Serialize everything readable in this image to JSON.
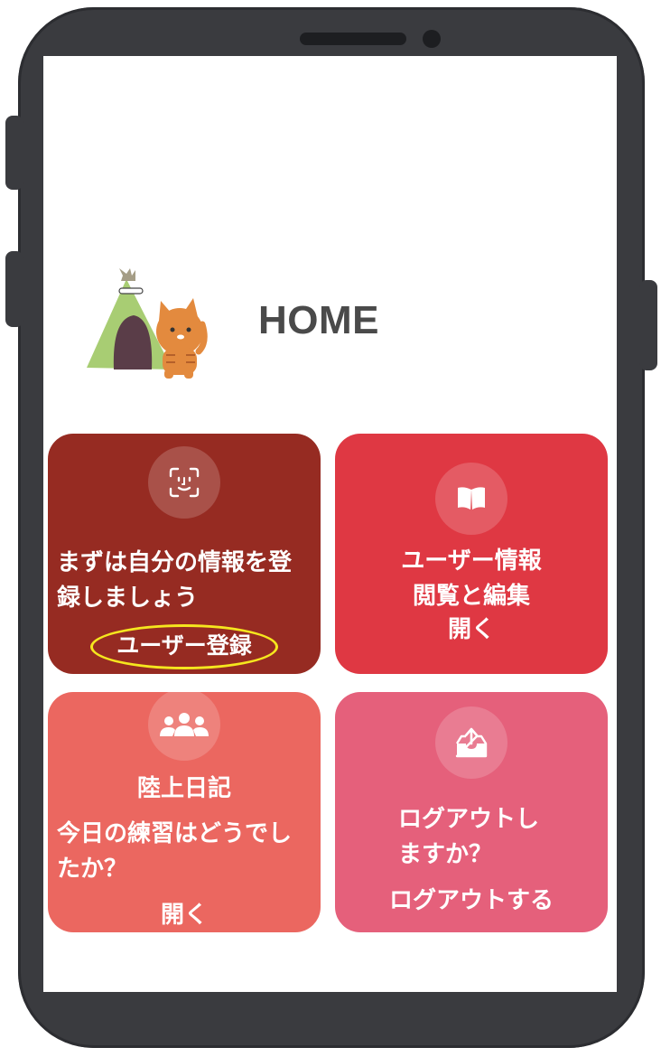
{
  "header": {
    "title": "HOME"
  },
  "tiles": {
    "register": {
      "description": "まずは自分の情報を登\n録しましょう",
      "action": "ユーザー登録",
      "icon": "face-id-icon",
      "color": "#962b22"
    },
    "user_info": {
      "title": "ユーザー情報\n閲覧と編集",
      "action": "開く",
      "icon": "book-icon",
      "color": "#df3843"
    },
    "diary": {
      "title": "陸上日記",
      "description": "今日の練習はどうでし\nたか？",
      "action": "開く",
      "icon": "group-icon",
      "color": "#eb6760"
    },
    "logout": {
      "description": "ログアウトし\nますか？",
      "action": "ログアウトする",
      "icon": "upload-tray-icon",
      "color": "#e5607b"
    }
  },
  "highlight": {
    "color": "#f5e61e"
  }
}
